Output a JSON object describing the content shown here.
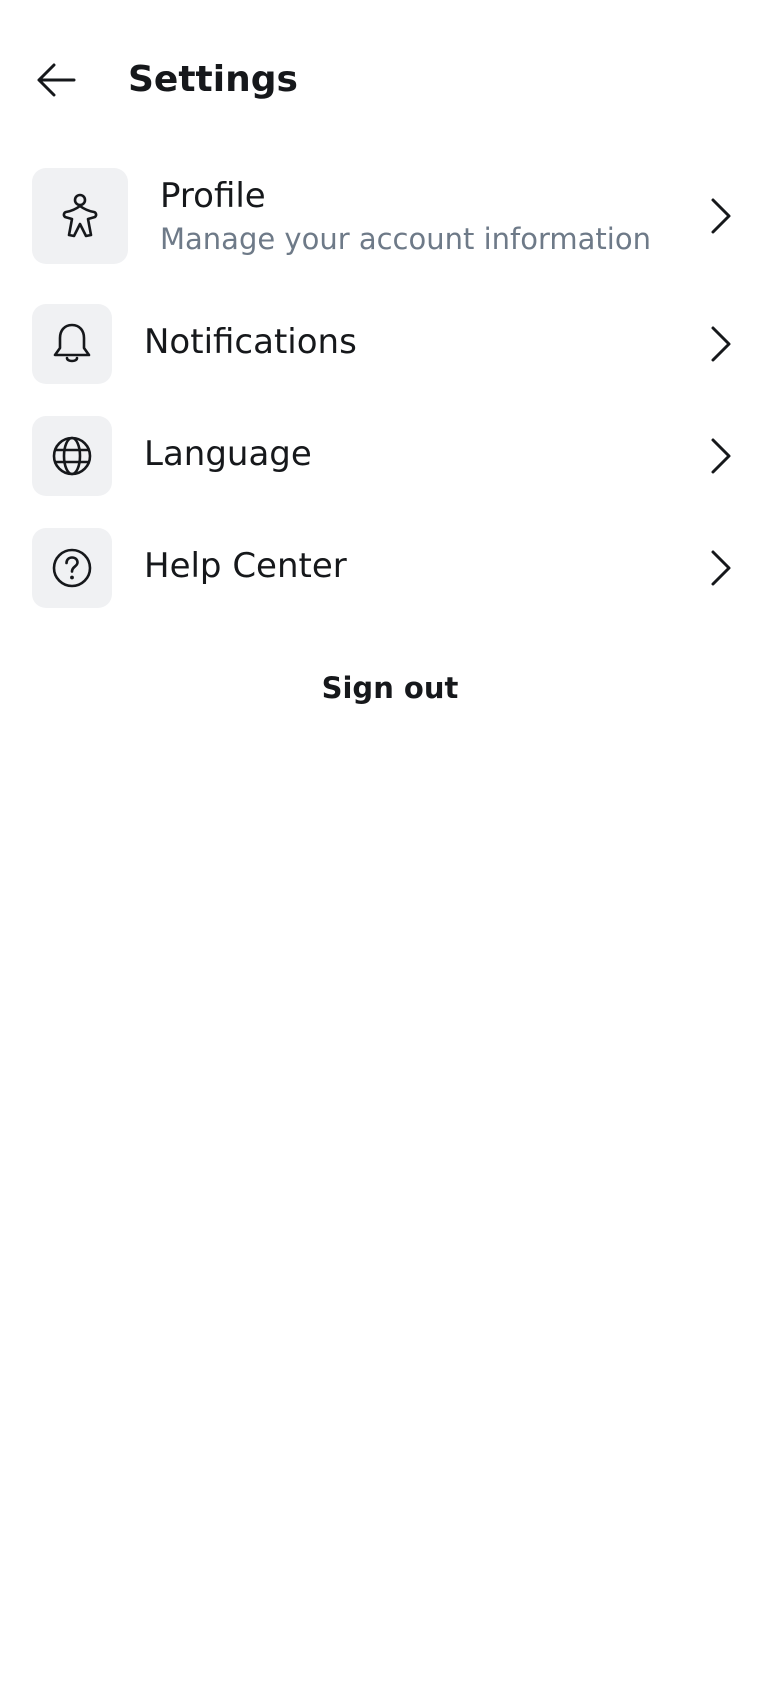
{
  "header": {
    "back_icon": "arrow-left-icon",
    "title": "Settings"
  },
  "items": [
    {
      "icon": "person-icon",
      "label": "Profile",
      "subtitle": "Manage your account information"
    },
    {
      "icon": "bell-icon",
      "label": "Notifications"
    },
    {
      "icon": "globe-icon",
      "label": "Language"
    },
    {
      "icon": "help-circle-icon",
      "label": "Help Center"
    }
  ],
  "sign_out": {
    "label": "Sign out"
  },
  "colors": {
    "text": "#16181b",
    "subtitle": "#6e7a88",
    "icon_tile": "#f0f1f3",
    "background": "#ffffff"
  }
}
